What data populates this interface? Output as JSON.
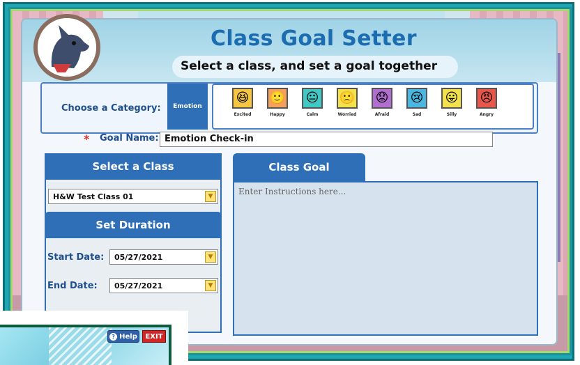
{
  "header": {
    "title": "Class Goal Setter",
    "subtitle": "Select a class, and set a goal together"
  },
  "category": {
    "label": "Choose a Category:",
    "selected": "Emotion",
    "emotions": [
      {
        "name": "Excited",
        "color": "#f6c640",
        "glyph": "😆"
      },
      {
        "name": "Happy",
        "color": "#f3a15c",
        "glyph": "🙂"
      },
      {
        "name": "Calm",
        "color": "#40c8c4",
        "glyph": "😐"
      },
      {
        "name": "Worried",
        "color": "#f3e14c",
        "glyph": "🙁"
      },
      {
        "name": "Afraid",
        "color": "#b06ed1",
        "glyph": "😟"
      },
      {
        "name": "Sad",
        "color": "#4ab7e3",
        "glyph": "😢"
      },
      {
        "name": "Silly",
        "color": "#f3e14c",
        "glyph": "😛"
      },
      {
        "name": "Angry",
        "color": "#e8564a",
        "glyph": "😠"
      }
    ]
  },
  "goal": {
    "required_mark": "*",
    "label": "Goal Name:",
    "value": "Emotion Check-in"
  },
  "select_class": {
    "header": "Select a Class",
    "value": "H&W Test Class 01"
  },
  "duration": {
    "header": "Set Duration",
    "start_label": "Start Date:",
    "start_value": "05/27/2021",
    "end_label": "End Date:",
    "end_value": "05/27/2021"
  },
  "class_goal": {
    "tab": "Class Goal",
    "placeholder": "Enter Instructions here..."
  },
  "popup": {
    "help_label": "Help",
    "exit_label": "EXIT"
  }
}
